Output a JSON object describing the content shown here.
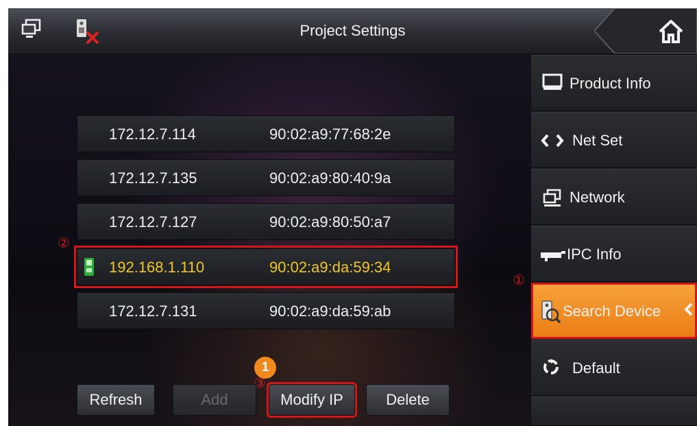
{
  "header": {
    "title": "Project Settings",
    "network_icon": "network-monitor-icon",
    "device_offline_icon": "device-offline-icon",
    "home_icon": "home-icon"
  },
  "devices": [
    {
      "ip": "172.12.7.114",
      "mac": "90:02:a9:77:68:2e",
      "selected": false
    },
    {
      "ip": "172.12.7.135",
      "mac": "90:02:a9:80:40:9a",
      "selected": false
    },
    {
      "ip": "172.12.7.127",
      "mac": "90:02:a9:80:50:a7",
      "selected": false
    },
    {
      "ip": "192.168.1.110",
      "mac": "90:02:a9:da:59:34",
      "selected": true
    },
    {
      "ip": "172.12.7.131",
      "mac": "90:02:a9:da:59:ab",
      "selected": false
    }
  ],
  "actions": {
    "refresh": "Refresh",
    "add": "Add",
    "modify_ip": "Modify IP",
    "delete": "Delete"
  },
  "annotations": {
    "step1": "①",
    "step2": "②",
    "step3": "③",
    "badge": "1"
  },
  "sidebar": {
    "items": [
      {
        "label": "Product Info",
        "icon": "monitor-icon"
      },
      {
        "label": "Net Set",
        "icon": "code-arrows-icon"
      },
      {
        "label": "Network",
        "icon": "network-icon"
      },
      {
        "label": "IPC Info",
        "icon": "camera-icon"
      },
      {
        "label": "Search Device",
        "icon": "search-device-icon",
        "active": true
      },
      {
        "label": "Default",
        "icon": "recycle-icon"
      }
    ]
  },
  "colors": {
    "accent_orange": "#ea7c14",
    "highlight_red": "#d4161b",
    "selected_text": "#f0c828"
  }
}
